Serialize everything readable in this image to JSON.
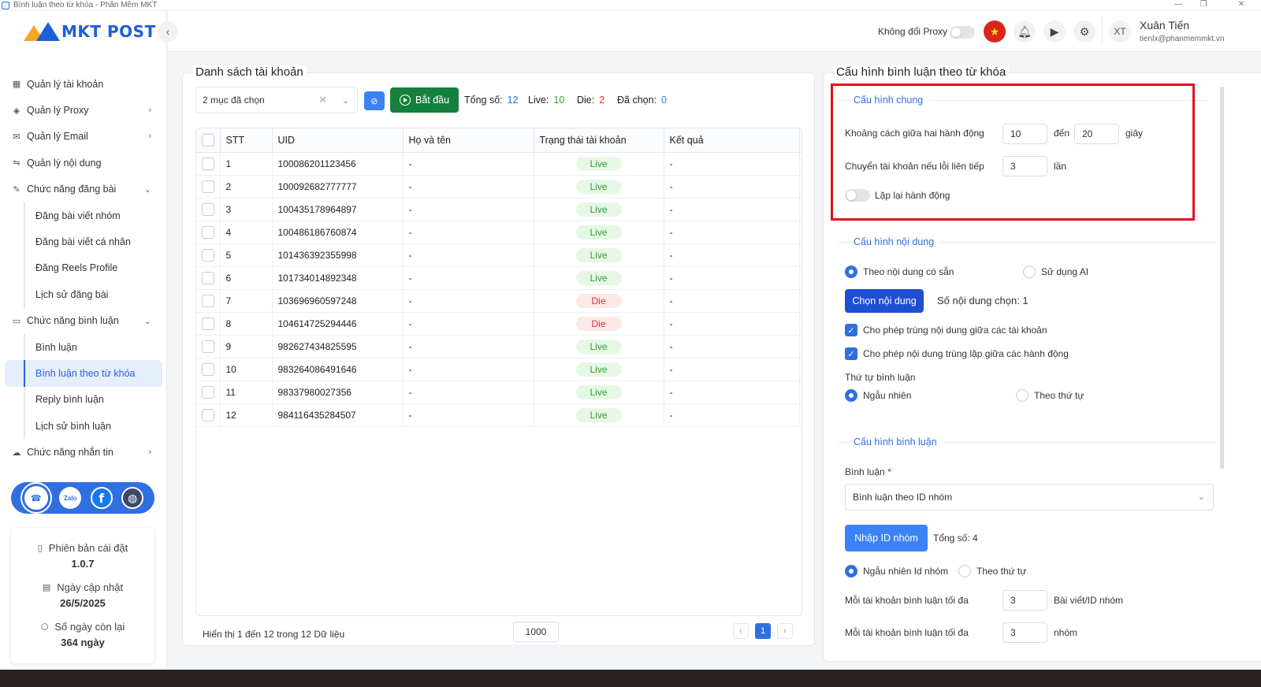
{
  "window": {
    "title": "Bình luận theo từ khóa - Phần Mềm MKT"
  },
  "logo": {
    "text": "MKT POST"
  },
  "sidebar": {
    "items": [
      {
        "label": "Quản lý tài khoản",
        "icon": "grid-icon"
      },
      {
        "label": "Quản lý Proxy",
        "icon": "layers-icon"
      },
      {
        "label": "Quản lý Email",
        "icon": "mail-icon"
      },
      {
        "label": "Quản lý nội dung",
        "icon": "swap-icon"
      },
      {
        "label": "Chức năng đăng bài",
        "icon": "edit-icon"
      },
      {
        "label": "Đăng bài viết nhóm"
      },
      {
        "label": "Đăng bài viết cá nhân"
      },
      {
        "label": "Đăng Reels Profile"
      },
      {
        "label": "Lịch sử đăng bài"
      },
      {
        "label": "Chức năng bình luận",
        "icon": "comment-icon"
      },
      {
        "label": "Bình luận"
      },
      {
        "label": "Bình luận theo từ khóa"
      },
      {
        "label": "Reply bình luận"
      },
      {
        "label": "Lịch sử bình luận"
      },
      {
        "label": "Chức năng nhắn tin",
        "icon": "chat-icon"
      }
    ],
    "info": {
      "version_label": "Phiên bản cài đặt",
      "version_value": "1.0.7",
      "update_label": "Ngày cập nhật",
      "update_value": "26/5/2025",
      "days_label": "Số ngày còn lại",
      "days_value": "364 ngày"
    }
  },
  "header": {
    "proxy_label": "Không đổi Proxy",
    "avatar_initials": "XT",
    "user_name": "Xuân Tiến",
    "user_email": "tienlx@phanmemmkt.vn"
  },
  "accounts": {
    "title": "Danh sách tài khoản",
    "select_value": "2 mục đã chọn",
    "start_label": "Bắt đầu",
    "stats": {
      "total_label": "Tổng số:",
      "total": "12",
      "live_label": "Live:",
      "live": "10",
      "die_label": "Die:",
      "die": "2",
      "selected_label": "Đã chọn:",
      "selected": "0"
    },
    "columns": [
      "STT",
      "UID",
      "Họ và tên",
      "Trạng thái tài khoản",
      "Kết quả"
    ],
    "rows": [
      {
        "stt": "1",
        "uid": "100086201123456",
        "name": "-",
        "status": "Live",
        "result": "-"
      },
      {
        "stt": "2",
        "uid": "100092682777777",
        "name": "-",
        "status": "Live",
        "result": "-"
      },
      {
        "stt": "3",
        "uid": "100435178964897",
        "name": "-",
        "status": "Live",
        "result": "-"
      },
      {
        "stt": "4",
        "uid": "100486186760874",
        "name": "-",
        "status": "Live",
        "result": "-"
      },
      {
        "stt": "5",
        "uid": "101436392355998",
        "name": "-",
        "status": "Live",
        "result": "-"
      },
      {
        "stt": "6",
        "uid": "101734014892348",
        "name": "-",
        "status": "Live",
        "result": "-"
      },
      {
        "stt": "7",
        "uid": "103696960597248",
        "name": "-",
        "status": "Die",
        "result": "-"
      },
      {
        "stt": "8",
        "uid": "104614725294446",
        "name": "-",
        "status": "Die",
        "result": "-"
      },
      {
        "stt": "9",
        "uid": "982627434825595",
        "name": "-",
        "status": "Live",
        "result": "-"
      },
      {
        "stt": "10",
        "uid": "983264086491646",
        "name": "-",
        "status": "Live",
        "result": "-"
      },
      {
        "stt": "11",
        "uid": "98337980027356",
        "name": "-",
        "status": "Live",
        "result": "-"
      },
      {
        "stt": "12",
        "uid": "984116435284507",
        "name": "-",
        "status": "Live",
        "result": "-"
      }
    ],
    "footer_text": "Hiển thị 1 đến 12 trong 12 Dữ liệu",
    "page_size": "1000",
    "current_page": "1"
  },
  "config": {
    "title": "Cấu hình bình luận theo từ khóa",
    "general": {
      "legend": "Cấu hình chung",
      "interval_label": "Khoảng cách giữa hai hành động",
      "interval_from": "10",
      "interval_to_label": "đến",
      "interval_to": "20",
      "interval_unit": "giây",
      "switch_label": "Chuyển tài khoản nếu lỗi liên tiếp",
      "switch_value": "3",
      "switch_unit": "lần",
      "repeat_label": "Lặp lại hành động"
    },
    "content": {
      "legend": "Cấu hình nội dung",
      "opt_existing": "Theo nội dung có sẵn",
      "opt_ai": "Sử dụng AI",
      "choose_button": "Chọn nội dung",
      "chosen_count": "Số nội dung chọn: 1",
      "allow_dup_accounts": "Cho phép trùng nội dung giữa các tài khoản",
      "allow_dup_actions": "Cho phép nội dung trùng lặp giữa các hành động",
      "order_label": "Thứ tự bình luận",
      "order_random": "Ngẫu nhiên",
      "order_sequential": "Theo thứ tự"
    },
    "comment": {
      "legend": "Cấu hình bình luận",
      "field_label": "Bình luận",
      "required_mark": "*",
      "field_value": "Bình luận theo ID nhóm",
      "import_button": "Nhập ID nhóm",
      "total": "Tổng số: 4",
      "opt_random_id": "Ngẫu nhiên Id nhóm",
      "opt_sequential": "Theo thứ tự",
      "max_posts_label": "Mỗi tài khoản bình luận tối đa",
      "max_posts_value": "3",
      "max_posts_unit": "Bài viết/ID nhóm",
      "max_groups_label": "Mỗi tài khoản bình luận tối đa",
      "max_groups_value": "3",
      "max_groups_unit": "nhóm"
    }
  },
  "colors": {
    "accent": "#2f6fe0",
    "start": "#15803d",
    "highlight_box": "#e0111c",
    "live": "#2f9e2f",
    "die": "#dd3333"
  }
}
